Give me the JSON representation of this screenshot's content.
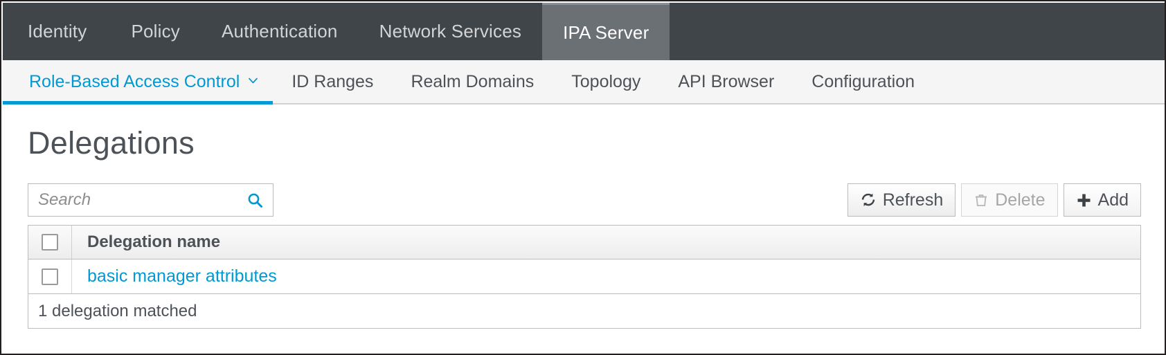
{
  "colors": {
    "topnav_bg": "#3f4549",
    "topnav_active_bg": "#6b7075",
    "accent_blue": "#0099d3",
    "subnav_bg": "#f5f5f5",
    "text_dark": "#4d5258",
    "border_gray": "#bcbcbc",
    "disabled_text": "#a6a6a6"
  },
  "topnav": {
    "items": [
      {
        "label": "Identity",
        "active": false
      },
      {
        "label": "Policy",
        "active": false
      },
      {
        "label": "Authentication",
        "active": false
      },
      {
        "label": "Network Services",
        "active": false
      },
      {
        "label": "IPA Server",
        "active": true
      }
    ]
  },
  "subnav": {
    "items": [
      {
        "label": "Role-Based Access Control",
        "active": true,
        "has_dropdown": true,
        "icon": "chevron-down-icon"
      },
      {
        "label": "ID Ranges",
        "active": false,
        "has_dropdown": false
      },
      {
        "label": "Realm Domains",
        "active": false,
        "has_dropdown": false
      },
      {
        "label": "Topology",
        "active": false,
        "has_dropdown": false
      },
      {
        "label": "API Browser",
        "active": false,
        "has_dropdown": false
      },
      {
        "label": "Configuration",
        "active": false,
        "has_dropdown": false
      }
    ]
  },
  "page": {
    "title": "Delegations"
  },
  "search": {
    "value": "",
    "placeholder": "Search",
    "icon": "search-icon"
  },
  "toolbar": {
    "refresh_label": "Refresh",
    "refresh_icon": "refresh-icon",
    "delete_label": "Delete",
    "delete_icon": "trash-icon",
    "delete_disabled": true,
    "add_label": "Add",
    "add_icon": "plus-icon"
  },
  "table": {
    "columns": [
      "Delegation name"
    ],
    "select_all_checked": false,
    "rows": [
      {
        "selected": false,
        "name": "basic manager attributes"
      }
    ],
    "footer": "1 delegation matched"
  }
}
